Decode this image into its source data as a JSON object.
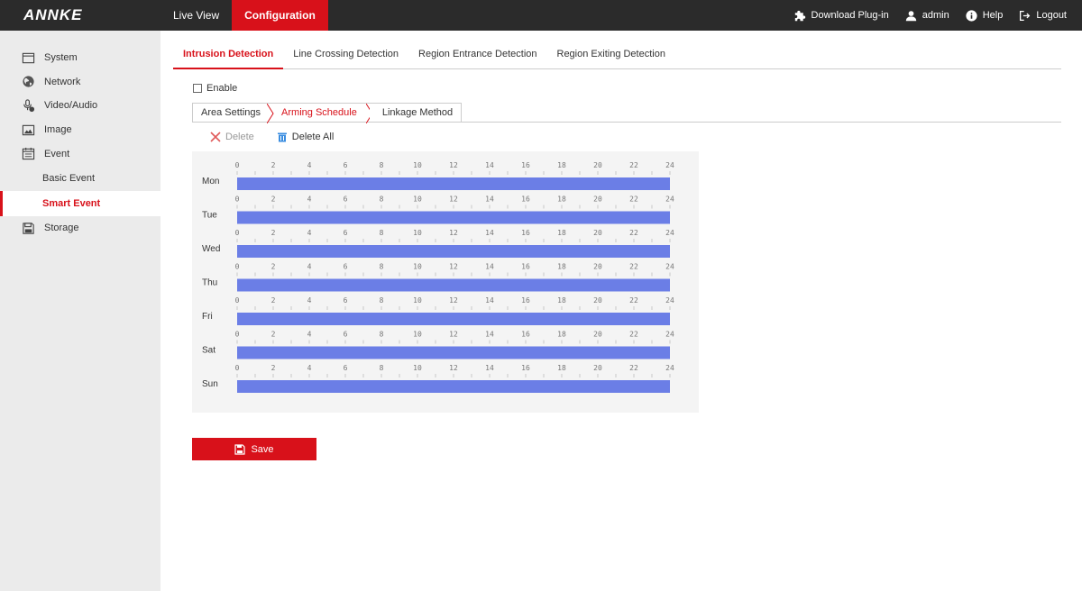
{
  "app": {
    "logo": "ANNKE"
  },
  "topnav": {
    "items": [
      {
        "label": "Live View",
        "active": false
      },
      {
        "label": "Configuration",
        "active": true
      }
    ]
  },
  "topright": {
    "plugin": "Download Plug-in",
    "user": "admin",
    "help": "Help",
    "logout": "Logout"
  },
  "sidebar": {
    "system": "System",
    "network": "Network",
    "video_audio": "Video/Audio",
    "image": "Image",
    "event": "Event",
    "basic_event": "Basic Event",
    "smart_event": "Smart Event",
    "storage": "Storage"
  },
  "tabs": [
    "Intrusion Detection",
    "Line Crossing Detection",
    "Region Entrance Detection",
    "Region Exiting Detection"
  ],
  "enable_label": "Enable",
  "subtabs": [
    "Area Settings",
    "Arming Schedule",
    "Linkage Method"
  ],
  "actions": {
    "delete": "Delete",
    "delete_all": "Delete All"
  },
  "schedule": {
    "hour_ticks": [
      "0",
      "2",
      "4",
      "6",
      "8",
      "10",
      "12",
      "14",
      "16",
      "18",
      "20",
      "22",
      "24"
    ],
    "days": [
      {
        "day": "Mon",
        "start": 0,
        "end": 24
      },
      {
        "day": "Tue",
        "start": 0,
        "end": 24
      },
      {
        "day": "Wed",
        "start": 0,
        "end": 24
      },
      {
        "day": "Thu",
        "start": 0,
        "end": 24
      },
      {
        "day": "Fri",
        "start": 0,
        "end": 24
      },
      {
        "day": "Sat",
        "start": 0,
        "end": 24
      },
      {
        "day": "Sun",
        "start": 0,
        "end": 24
      }
    ],
    "bar_color": "#6b7ee6"
  },
  "save_label": "Save",
  "colors": {
    "accent": "#d8111a",
    "topbar": "#2b2b2b",
    "sidebar": "#ebebeb"
  }
}
